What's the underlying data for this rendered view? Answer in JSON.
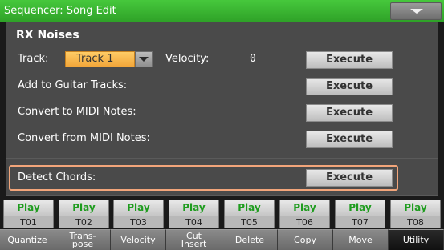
{
  "title": "Sequencer: Song Edit",
  "section_title": "RX Noises",
  "track_label": "Track:",
  "track_value": "Track 1",
  "velocity_label": "Velocity:",
  "velocity_value": "0",
  "rows": [
    {
      "label": "Add to Guitar Tracks:",
      "button": "Execute"
    },
    {
      "label": "Convert to MIDI Notes:",
      "button": "Execute"
    },
    {
      "label": "Convert from MIDI Notes:",
      "button": "Execute"
    }
  ],
  "rx_execute": "Execute",
  "detect_chords": {
    "label": "Detect Chords:",
    "button": "Execute"
  },
  "play_buttons": [
    "Play",
    "Play",
    "Play",
    "Play",
    "Play",
    "Play",
    "Play",
    "Play"
  ],
  "tracks": [
    "T01",
    "T02",
    "T03",
    "T04",
    "T05",
    "T06",
    "T07",
    "T08"
  ],
  "tabs": [
    {
      "label": "Quantize",
      "active": false
    },
    {
      "label": "Trans-\npose",
      "active": false
    },
    {
      "label": "Velocity",
      "active": false
    },
    {
      "label": "Cut\nInsert",
      "active": false
    },
    {
      "label": "Delete",
      "active": false
    },
    {
      "label": "Copy",
      "active": false
    },
    {
      "label": "Move",
      "active": false
    },
    {
      "label": "Utility",
      "active": true
    }
  ],
  "colors": {
    "title_bar": "#2fa228",
    "track_combo": "#f2a63a",
    "highlight_frame": "#f2a57a",
    "play_text": "#1e9c1e"
  }
}
